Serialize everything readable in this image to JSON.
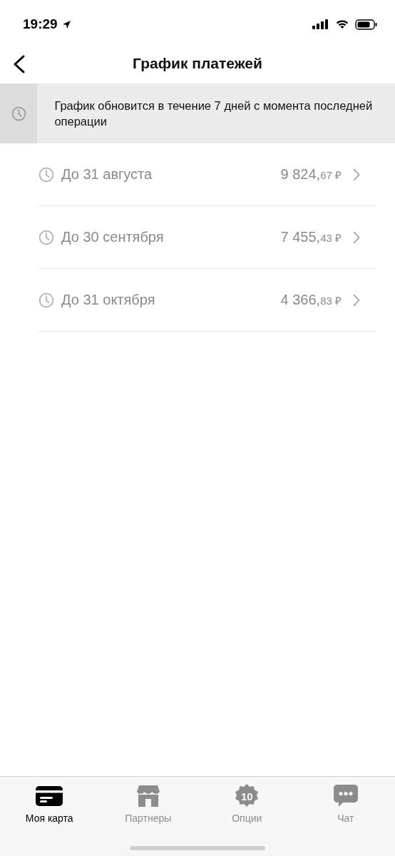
{
  "status_bar": {
    "time": "19:29"
  },
  "header": {
    "title": "График платежей"
  },
  "notice": {
    "text": "График обновится в течение 7 дней с момента последней операции"
  },
  "payments": [
    {
      "label": "До 31 августа",
      "amount": "9 824,",
      "fraction": "67",
      "currency": "₽"
    },
    {
      "label": "До 30 сентября",
      "amount": "7 455,",
      "fraction": "43",
      "currency": "₽"
    },
    {
      "label": "До 31 октября",
      "amount": "4 366,",
      "fraction": "83",
      "currency": "₽"
    }
  ],
  "tab_bar": [
    {
      "kind": "card",
      "label": "Моя карта",
      "selected": true
    },
    {
      "kind": "shop",
      "label": "Партнеры",
      "selected": false
    },
    {
      "kind": "badge",
      "label": "Опции",
      "badge": "10",
      "selected": false
    },
    {
      "kind": "chat",
      "label": "Чат",
      "selected": false
    }
  ]
}
